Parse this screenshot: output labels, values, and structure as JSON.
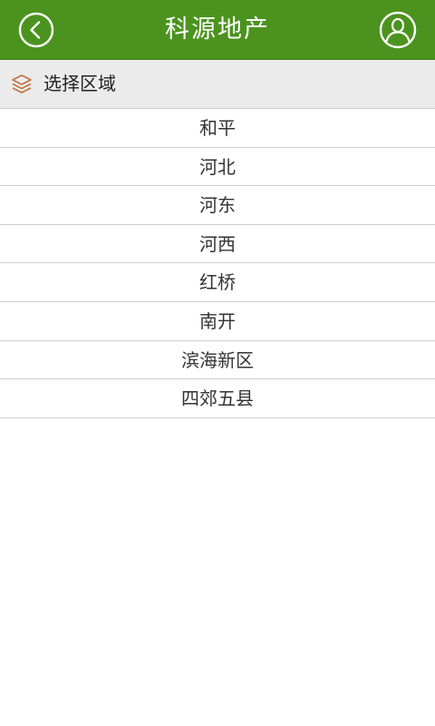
{
  "header": {
    "title": "科源地产",
    "back_icon": "back-circle-icon",
    "user_icon": "user-profile-icon",
    "background_color": "#4b931e"
  },
  "section": {
    "title": "选择区域",
    "icon": "layers-icon",
    "icon_color": "#c0723f"
  },
  "regions": [
    {
      "label": "和平"
    },
    {
      "label": "河北"
    },
    {
      "label": "河东"
    },
    {
      "label": "河西"
    },
    {
      "label": "红桥"
    },
    {
      "label": "南开"
    },
    {
      "label": "滨海新区"
    },
    {
      "label": "四郊五县"
    }
  ]
}
